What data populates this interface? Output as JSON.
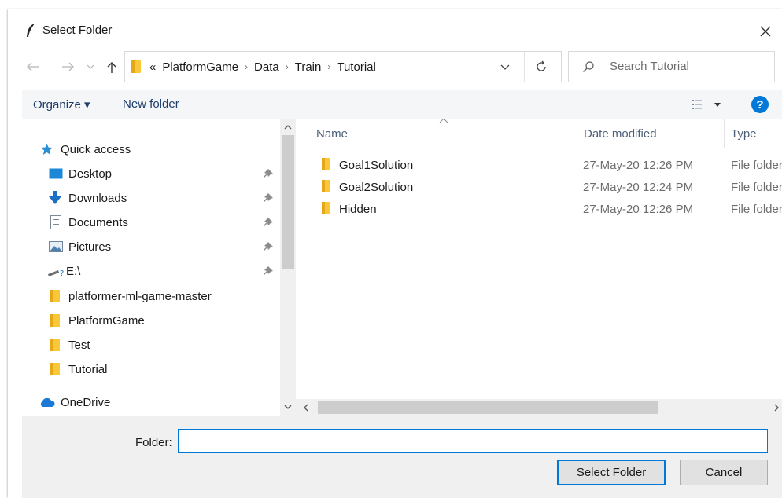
{
  "title": "Select Folder",
  "nav": {
    "address_prefix": "«",
    "breadcrumbs": [
      "PlatformGame",
      "Data",
      "Train",
      "Tutorial"
    ]
  },
  "search": {
    "placeholder": "Search Tutorial"
  },
  "toolbar": {
    "organize_label": "Organize ▾",
    "new_folder_label": "New folder"
  },
  "sidebar": {
    "items": [
      {
        "label": "Quick access",
        "icon": "star-icon"
      },
      {
        "label": "Desktop",
        "icon": "desktop-icon",
        "pinned": true
      },
      {
        "label": "Downloads",
        "icon": "download-arrow-icon",
        "pinned": true
      },
      {
        "label": "Documents",
        "icon": "document-icon",
        "pinned": true
      },
      {
        "label": "Pictures",
        "icon": "pictures-icon",
        "pinned": true
      },
      {
        "label": "E:\\",
        "icon": "drive-icon",
        "pinned": true
      },
      {
        "label": "platformer-ml-game-master",
        "icon": "folder-icon"
      },
      {
        "label": "PlatformGame",
        "icon": "folder-icon"
      },
      {
        "label": "Test",
        "icon": "folder-icon"
      },
      {
        "label": "Tutorial",
        "icon": "folder-icon"
      },
      {
        "label": "OneDrive",
        "icon": "cloud-icon"
      }
    ]
  },
  "list": {
    "columns": [
      "Name",
      "Date modified",
      "Type"
    ],
    "rows": [
      {
        "name": "Goal1Solution",
        "date": "27-May-20 12:26 PM",
        "type": "File folder"
      },
      {
        "name": "Goal2Solution",
        "date": "27-May-20 12:24 PM",
        "type": "File folder"
      },
      {
        "name": "Hidden",
        "date": "27-May-20 12:26 PM",
        "type": "File folder"
      }
    ]
  },
  "footer": {
    "folder_label": "Folder:",
    "folder_value": "",
    "select_label": "Select Folder",
    "cancel_label": "Cancel"
  },
  "colors": {
    "accent": "#0078d7",
    "folder": "#f8c73c",
    "link": "#1e3d6b"
  }
}
